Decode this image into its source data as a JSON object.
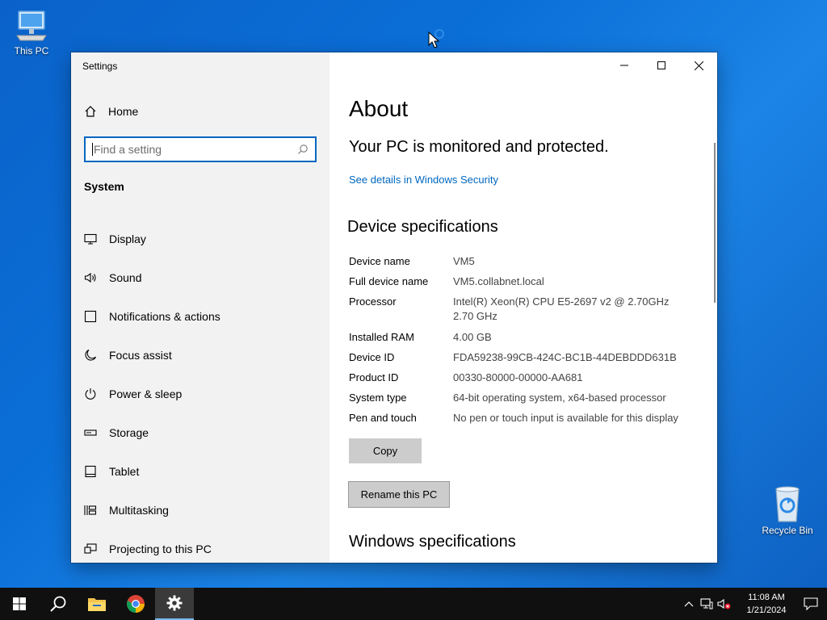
{
  "desktop": {
    "icons": [
      {
        "label": "This PC",
        "icon": "computer-icon"
      },
      {
        "label": "Recycle Bin",
        "icon": "recycle-bin-icon"
      }
    ]
  },
  "window": {
    "title": "Settings",
    "controls": {
      "minimize": "minimize-icon",
      "maximize": "maximize-icon",
      "close": "close-icon"
    }
  },
  "sidebar": {
    "home_label": "Home",
    "search_placeholder": "Find a setting",
    "search_value": "",
    "section": "System",
    "items": [
      {
        "label": "Display",
        "icon": "monitor-icon"
      },
      {
        "label": "Sound",
        "icon": "speaker-icon"
      },
      {
        "label": "Notifications & actions",
        "icon": "notification-icon"
      },
      {
        "label": "Focus assist",
        "icon": "moon-icon"
      },
      {
        "label": "Power & sleep",
        "icon": "power-icon"
      },
      {
        "label": "Storage",
        "icon": "storage-icon"
      },
      {
        "label": "Tablet",
        "icon": "tablet-icon"
      },
      {
        "label": "Multitasking",
        "icon": "multitasking-icon"
      },
      {
        "label": "Projecting to this PC",
        "icon": "projecting-icon"
      }
    ]
  },
  "content": {
    "title": "About",
    "protection_status": "Your PC is monitored and protected.",
    "security_link": "See details in Windows Security",
    "device_specs_heading": "Device specifications",
    "specs": [
      {
        "key": "Device name",
        "value": "VM5"
      },
      {
        "key": "Full device name",
        "value": "VM5.collabnet.local"
      },
      {
        "key": "Processor",
        "value": "Intel(R) Xeon(R) CPU E5-2697 v2 @ 2.70GHz",
        "value2": "2.70 GHz"
      },
      {
        "key": "Installed RAM",
        "value": "4.00 GB"
      },
      {
        "key": "Device ID",
        "value": "FDA59238-99CB-424C-BC1B-44DEBDDD631B"
      },
      {
        "key": "Product ID",
        "value": "00330-80000-00000-AA681"
      },
      {
        "key": "System type",
        "value": "64-bit operating system, x64-based processor"
      },
      {
        "key": "Pen and touch",
        "value": "No pen or touch input is available for this display"
      }
    ],
    "copy_button": "Copy",
    "rename_button": "Rename this PC",
    "windows_specs_heading": "Windows specifications"
  },
  "taskbar": {
    "apps": [
      "start-icon",
      "search-icon",
      "file-explorer-icon",
      "chrome-icon",
      "settings-icon"
    ],
    "active_app": "settings-icon",
    "time": "11:08 AM",
    "date": "1/21/2024"
  },
  "colors": {
    "accent": "#0067c0",
    "taskbar": "#101010",
    "sidebar": "#f2f2f2"
  }
}
